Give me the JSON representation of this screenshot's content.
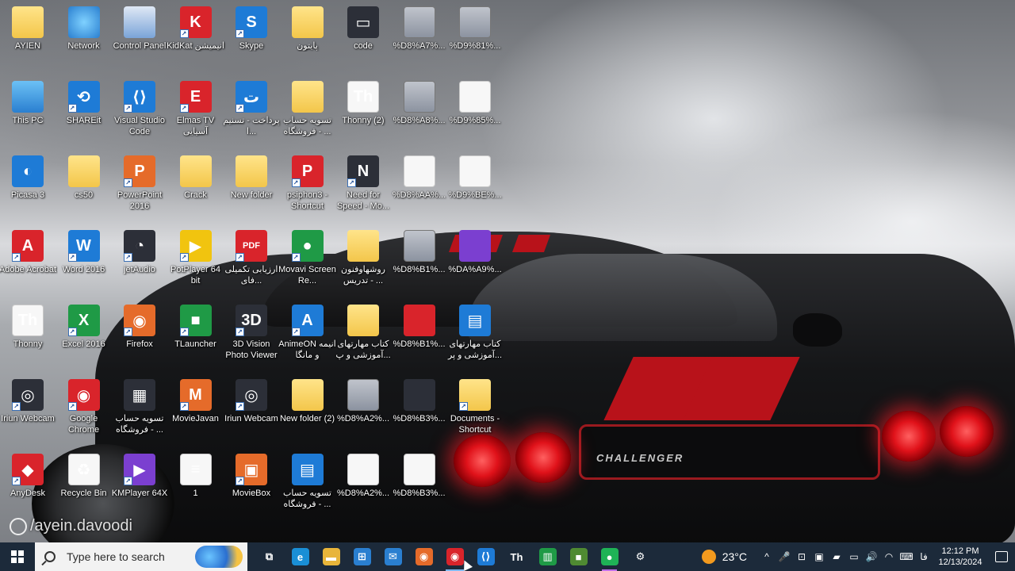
{
  "desktop": {
    "icons": [
      {
        "label": "AYIEN",
        "icon": "user-folder-icon",
        "type": "folder"
      },
      {
        "label": "Network",
        "icon": "network-icon",
        "type": "net"
      },
      {
        "label": "Control Panel",
        "icon": "control-panel-icon",
        "type": "cp"
      },
      {
        "label": "KidKat انیمیشن",
        "icon": "kidkat-icon",
        "type": "red",
        "glyph": "K",
        "shortcut": true
      },
      {
        "label": "Skype",
        "icon": "skype-icon",
        "type": "blue",
        "glyph": "S",
        "shortcut": true
      },
      {
        "label": "پایتون",
        "icon": "python-folder-icon",
        "type": "folder"
      },
      {
        "label": "code",
        "icon": "code-file-icon",
        "type": "dark",
        "glyph": "▭"
      },
      {
        "label": "%D8%A7%...",
        "icon": "pdf-book-icon",
        "type": "book"
      },
      {
        "label": "%D9%81%...",
        "icon": "pdf-book-icon",
        "type": "book"
      },
      {
        "label": "This PC",
        "icon": "this-pc-icon",
        "type": "pc"
      },
      {
        "label": "SHAREit",
        "icon": "shareit-icon",
        "type": "blue",
        "glyph": "⟲",
        "shortcut": true
      },
      {
        "label": "Visual Studio Code",
        "icon": "vscode-icon",
        "type": "blue",
        "glyph": "⟨⟩",
        "shortcut": true
      },
      {
        "label": "Elmas TV آسیایی",
        "icon": "elmas-tv-icon",
        "type": "red",
        "glyph": "E",
        "shortcut": true
      },
      {
        "label": "پرداخت - تسنیم ا...",
        "icon": "chrome-web-shortcut-icon",
        "type": "blue",
        "glyph": "ت",
        "shortcut": true
      },
      {
        "label": "تسویه حساب فروشگاه - ...",
        "icon": "folder-icon",
        "type": "folder"
      },
      {
        "label": "Thonny (2)",
        "icon": "thonny-icon",
        "type": "doc",
        "glyph": "Th"
      },
      {
        "label": "%D8%A8%...",
        "icon": "pdf-book-icon",
        "type": "book"
      },
      {
        "label": "%D9%85%...",
        "icon": "pdf-book-icon",
        "type": "doc"
      },
      {
        "label": "Picasa 3",
        "icon": "picasa-icon",
        "type": "blue",
        "glyph": "◐"
      },
      {
        "label": "cs50",
        "icon": "folder-icon",
        "type": "folder"
      },
      {
        "label": "PowerPoint 2016",
        "icon": "powerpoint-icon",
        "type": "orange",
        "glyph": "P",
        "shortcut": true
      },
      {
        "label": "Crack",
        "icon": "crack-folder-icon",
        "type": "folder"
      },
      {
        "label": "New folder",
        "icon": "folder-icon",
        "type": "folder"
      },
      {
        "label": "psiphon3 - Shortcut",
        "icon": "psiphon-icon",
        "type": "red",
        "glyph": "P",
        "shortcut": true
      },
      {
        "label": "Need for Speed - Mo...",
        "icon": "nfs-game-icon",
        "type": "dark",
        "glyph": "N",
        "shortcut": true
      },
      {
        "label": "%D8%AA%...",
        "icon": "pdf-book-icon",
        "type": "doc"
      },
      {
        "label": "%D9%BE%...",
        "icon": "pdf-book-icon",
        "type": "doc"
      },
      {
        "label": "Adobe Acrobat",
        "icon": "acrobat-icon",
        "type": "red",
        "glyph": "A",
        "shortcut": true
      },
      {
        "label": "Word 2016",
        "icon": "word-icon",
        "type": "blue",
        "glyph": "W",
        "shortcut": true
      },
      {
        "label": "jetAudio",
        "icon": "jetaudio-icon",
        "type": "dark",
        "glyph": "◔",
        "shortcut": true
      },
      {
        "label": "PotPlayer 64 bit",
        "icon": "potplayer-icon",
        "type": "yellow",
        "glyph": "▶",
        "shortcut": true
      },
      {
        "label": "ارزیابی تکمیلی فای...",
        "icon": "pdf-file-icon",
        "type": "red",
        "glyph": "PDF",
        "shortcut": true
      },
      {
        "label": "Movavi Screen Re...",
        "icon": "movavi-icon",
        "type": "green",
        "glyph": "●",
        "shortcut": true
      },
      {
        "label": "روشهاوفنون تدریس - ...",
        "icon": "folder-icon",
        "type": "folder"
      },
      {
        "label": "%D8%B1%...",
        "icon": "pdf-book-icon",
        "type": "book"
      },
      {
        "label": "%DA%A9%...",
        "icon": "pdf-book-icon",
        "type": "purple"
      },
      {
        "label": "Thonny",
        "icon": "thonny-icon",
        "type": "doc",
        "glyph": "Th"
      },
      {
        "label": "Excel 2016",
        "icon": "excel-icon",
        "type": "green",
        "glyph": "X",
        "shortcut": true
      },
      {
        "label": "Firefox",
        "icon": "firefox-icon",
        "type": "orange",
        "glyph": "◉",
        "shortcut": true
      },
      {
        "label": "TLauncher",
        "icon": "tlauncher-icon",
        "type": "green",
        "glyph": "■",
        "shortcut": true
      },
      {
        "label": "3D Vision Photo Viewer",
        "icon": "3d-vision-icon",
        "type": "dark",
        "glyph": "3D",
        "shortcut": true
      },
      {
        "label": "AnimeON انیمه و مانگا",
        "icon": "animeon-icon",
        "type": "blue",
        "glyph": "A",
        "shortcut": true
      },
      {
        "label": "کتاب مهارتهای آموزشی و پ...",
        "icon": "folder-icon",
        "type": "folder"
      },
      {
        "label": "%D8%B1%...",
        "icon": "pdf-book-icon",
        "type": "red"
      },
      {
        "label": "کتاب مهارتهای آموزشی و پر...",
        "icon": "document-icon",
        "type": "blue",
        "glyph": "▤"
      },
      {
        "label": "Iriun Webcam",
        "icon": "iriun-webcam-icon",
        "type": "dark",
        "glyph": "◎",
        "shortcut": true
      },
      {
        "label": "Google Chrome",
        "icon": "chrome-icon",
        "type": "red",
        "glyph": "◉",
        "shortcut": true
      },
      {
        "label": "تسویه حساب فروشگاه - ...",
        "icon": "folder-icon",
        "type": "dark",
        "glyph": "▦"
      },
      {
        "label": "MovieJavan",
        "icon": "moviejavan-icon",
        "type": "orange",
        "glyph": "M",
        "shortcut": true
      },
      {
        "label": "Iriun Webcam",
        "icon": "iriun-webcam-icon",
        "type": "dark",
        "glyph": "◎",
        "shortcut": true
      },
      {
        "label": "New folder (2)",
        "icon": "folder-icon",
        "type": "folder"
      },
      {
        "label": "%D8%A2%...",
        "icon": "pdf-book-icon",
        "type": "book"
      },
      {
        "label": "%D8%B3%...",
        "icon": "pdf-book-icon",
        "type": "dark"
      },
      {
        "label": "Documents - Shortcut",
        "icon": "documents-folder-icon",
        "type": "folder",
        "shortcut": true
      },
      {
        "label": "AnyDesk",
        "icon": "anydesk-icon",
        "type": "red",
        "glyph": "◆",
        "shortcut": true
      },
      {
        "label": "Recycle Bin",
        "icon": "recycle-bin-icon",
        "type": "doc",
        "glyph": "♻"
      },
      {
        "label": "KMPlayer 64X",
        "icon": "kmplayer-icon",
        "type": "purple",
        "glyph": "▶",
        "shortcut": true
      },
      {
        "label": "1",
        "icon": "text-file-icon",
        "type": "doc",
        "glyph": "≡"
      },
      {
        "label": "MovieBox",
        "icon": "moviebox-icon",
        "type": "orange",
        "glyph": "▣",
        "shortcut": true
      },
      {
        "label": "تسویه حساب فروشگاه - ...",
        "icon": "document-icon",
        "type": "blue",
        "glyph": "▤"
      },
      {
        "label": "%D8%A2%...",
        "icon": "pdf-book-icon",
        "type": "doc"
      },
      {
        "label": "%D8%B3%...",
        "icon": "pdf-book-icon",
        "type": "doc"
      }
    ]
  },
  "wallpaper": {
    "car_badge": "CHALLENGER"
  },
  "watermark": {
    "text": "/ayein.davoodi"
  },
  "taskbar": {
    "search_placeholder": "Type here to search",
    "pinned": [
      {
        "name": "task-view-icon",
        "glyph": "⧉",
        "color": "#1c2a3a"
      },
      {
        "name": "edge-icon",
        "glyph": "e",
        "color": "#1a8fd6"
      },
      {
        "name": "file-explorer-icon",
        "glyph": "▬",
        "color": "#e8b53a"
      },
      {
        "name": "microsoft-store-icon",
        "glyph": "⊞",
        "color": "#2a7fd0"
      },
      {
        "name": "mail-icon",
        "glyph": "✉",
        "color": "#2a7fd0"
      },
      {
        "name": "firefox-icon",
        "glyph": "◉",
        "color": "#e56b2a"
      },
      {
        "name": "chrome-icon",
        "glyph": "◉",
        "color": "#d9242b",
        "active": true
      },
      {
        "name": "vscode-icon",
        "glyph": "⟨⟩",
        "color": "#1e7bd6"
      },
      {
        "name": "thonny-icon",
        "glyph": "Th",
        "color": "#1c2a3a"
      },
      {
        "name": "excel-icon",
        "glyph": "▥",
        "color": "#1f9a46"
      },
      {
        "name": "minecraft-icon",
        "glyph": "■",
        "color": "#4f8a32"
      },
      {
        "name": "movavi-icon",
        "glyph": "●",
        "color": "#1fb356",
        "running": true
      },
      {
        "name": "settings-icon",
        "glyph": "⚙",
        "color": "#1c2a3a"
      }
    ],
    "weather": "23°C",
    "tray": [
      {
        "name": "show-hidden-icons-icon",
        "glyph": "^"
      },
      {
        "name": "microphone-icon",
        "glyph": "🎤"
      },
      {
        "name": "usb-icon",
        "glyph": "⊡"
      },
      {
        "name": "display-icon",
        "glyph": "▣"
      },
      {
        "name": "nvidia-icon",
        "glyph": "▰"
      },
      {
        "name": "battery-icon",
        "glyph": "▭"
      },
      {
        "name": "volume-icon",
        "glyph": "🔊"
      },
      {
        "name": "wifi-icon",
        "glyph": "◠"
      },
      {
        "name": "keyboard-icon",
        "glyph": "⌨"
      },
      {
        "name": "language-indicator",
        "glyph": "فا"
      }
    ],
    "time": "12:12 PM",
    "date": "12/13/2024"
  }
}
